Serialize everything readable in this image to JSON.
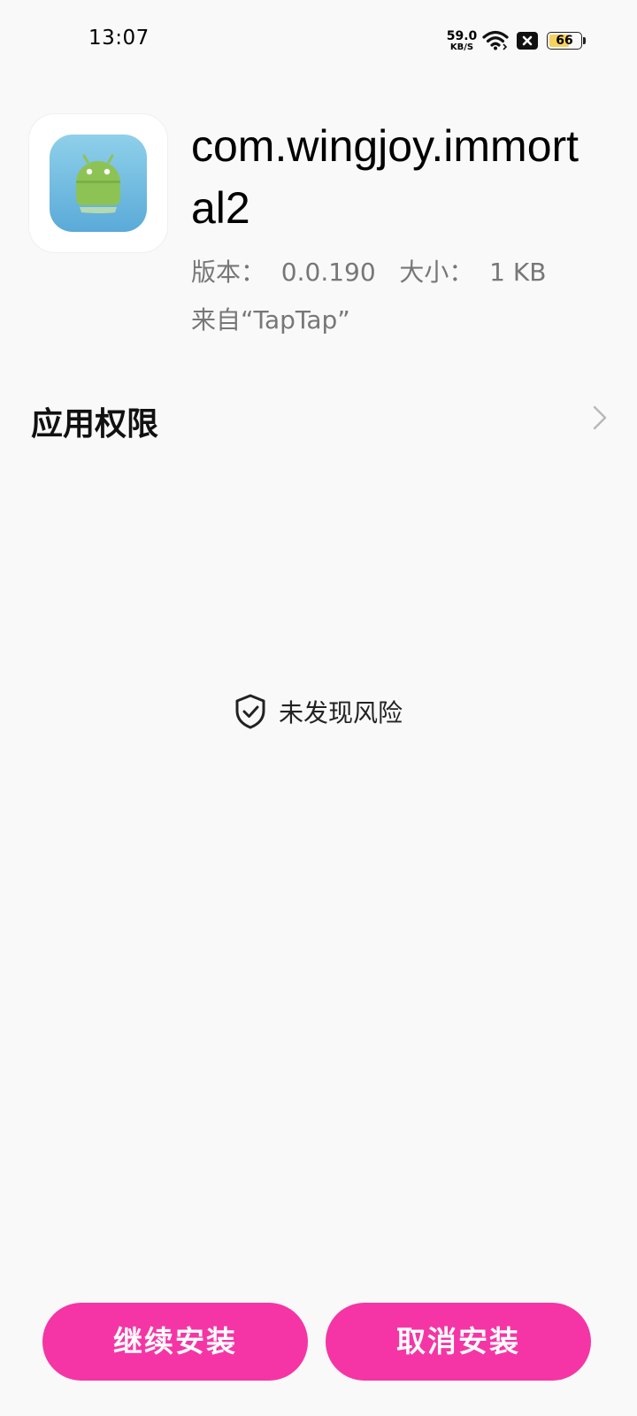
{
  "status_bar": {
    "time": "13:07",
    "net_speed_value": "59.0",
    "net_speed_unit": "KB/S",
    "battery_level": "66",
    "battery_fill_fraction": 0.66,
    "icons": [
      "wifi-icon",
      "close-badge-icon",
      "battery-icon"
    ]
  },
  "app": {
    "package_name": "com.wingjoy.immortal2",
    "icon": "android-robot-icon",
    "version_line": "版本：  0.0.190   大小：  1 KB",
    "source_line": "来自“TapTap”"
  },
  "permissions": {
    "title": "应用权限",
    "icon": "chevron-right-icon"
  },
  "security": {
    "icon": "shield-check-icon",
    "text": "未发现风险"
  },
  "actions": {
    "continue_label": "继续安装",
    "cancel_label": "取消安装"
  },
  "colors": {
    "background": "#f9f9fa",
    "button": "#f535a5",
    "button_text": "#ffffff",
    "secondary_text": "#777777",
    "battery_fill": "#f4d35e",
    "app_icon_gradient_top": "#8fd0ea",
    "app_icon_gradient_bottom": "#5aaad8",
    "android_green": "#8dc355"
  }
}
